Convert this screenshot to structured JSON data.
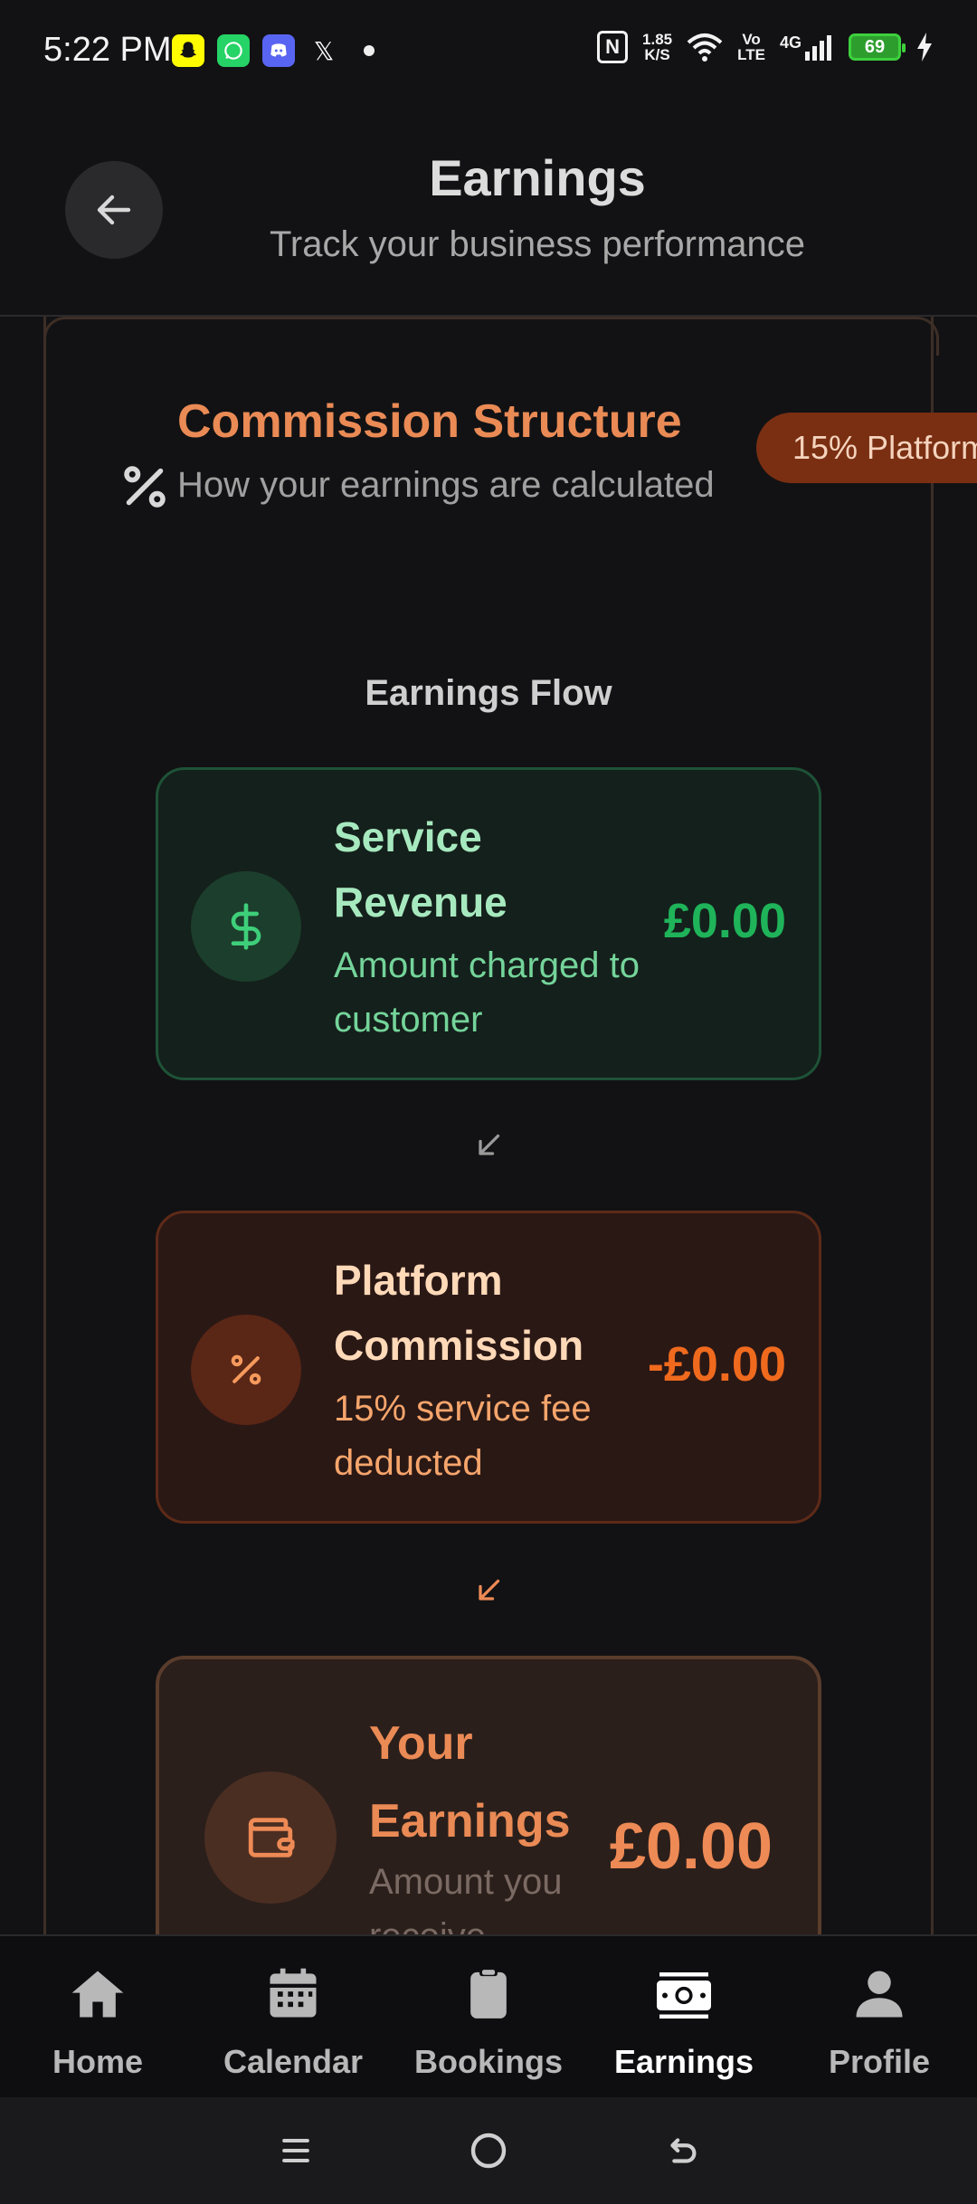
{
  "status_bar": {
    "time": "5:22 PM",
    "net_speed_value": "1.85",
    "net_speed_unit": "K/S",
    "volte_top": "Vo",
    "volte_bottom": "LTE",
    "network": "4G",
    "battery": "69",
    "notification_icons": [
      "snapchat-icon",
      "whatsapp-icon",
      "discord-icon",
      "x-icon"
    ]
  },
  "header": {
    "title": "Earnings",
    "subtitle": "Track your business performance"
  },
  "commission": {
    "title": "Commission Structure",
    "subtitle": "How your earnings are calculated",
    "badge": "15% Platform"
  },
  "flow": {
    "title": "Earnings Flow",
    "cards": [
      {
        "title": "Service Revenue",
        "description": "Amount charged to customer",
        "amount": "£0.00",
        "icon": "dollar-icon",
        "color": "#1fb35a"
      },
      {
        "title": "Platform Commission",
        "description": "15% service fee deducted",
        "amount": "-£0.00",
        "icon": "percent-icon",
        "color": "#f06a1e"
      },
      {
        "title": "Your Earnings",
        "description": "Amount you receive",
        "amount": "£0.00",
        "icon": "wallet-icon",
        "color": "#ee8a55"
      }
    ]
  },
  "nav": {
    "items": [
      {
        "label": "Home",
        "icon": "home-icon",
        "active": false
      },
      {
        "label": "Calendar",
        "icon": "calendar-icon",
        "active": false
      },
      {
        "label": "Bookings",
        "icon": "clipboard-icon",
        "active": false
      },
      {
        "label": "Earnings",
        "icon": "money-icon",
        "active": true
      },
      {
        "label": "Profile",
        "icon": "person-icon",
        "active": false
      }
    ]
  }
}
